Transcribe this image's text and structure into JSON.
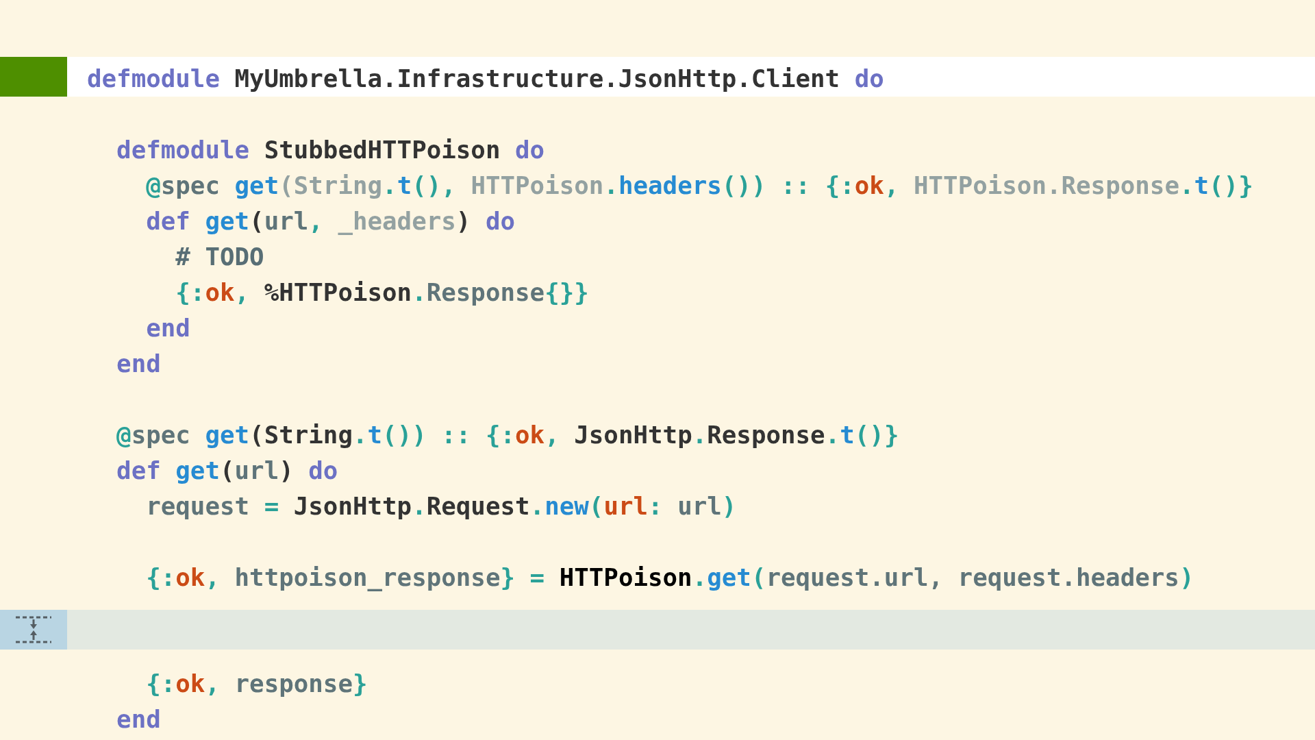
{
  "editor": {
    "lines": [
      {
        "kind": "code",
        "current": true,
        "tokens": [
          {
            "kind": "kw",
            "text": "defmodule "
          },
          {
            "kind": "mod",
            "text": "MyUmbrella.Infrastructure.JsonHttp.Client "
          },
          {
            "kind": "kw",
            "text": "do"
          }
        ]
      },
      {
        "kind": "blank",
        "current": false
      },
      {
        "kind": "code",
        "current": false,
        "tokens": [
          {
            "kind": "kw",
            "text": "  defmodule "
          },
          {
            "kind": "mod",
            "text": "StubbedHTTPoison "
          },
          {
            "kind": "kw",
            "text": "do"
          }
        ]
      },
      {
        "kind": "code",
        "current": false,
        "tokens": [
          {
            "kind": "punct",
            "text": "    @"
          },
          {
            "kind": "var",
            "text": "spec "
          },
          {
            "kind": "fn",
            "text": "get"
          },
          {
            "kind": "type",
            "text": "(String"
          },
          {
            "kind": "punct",
            "text": "."
          },
          {
            "kind": "fn",
            "text": "t"
          },
          {
            "kind": "punct",
            "text": "(), "
          },
          {
            "kind": "type",
            "text": "HTTPoison"
          },
          {
            "kind": "punct",
            "text": "."
          },
          {
            "kind": "fn",
            "text": "headers"
          },
          {
            "kind": "punct",
            "text": "()) :: {:"
          },
          {
            "kind": "atom",
            "text": "ok"
          },
          {
            "kind": "punct",
            "text": ", "
          },
          {
            "kind": "type",
            "text": "HTTPoison.Response"
          },
          {
            "kind": "punct",
            "text": "."
          },
          {
            "kind": "fn",
            "text": "t"
          },
          {
            "kind": "punct",
            "text": "()}"
          }
        ]
      },
      {
        "kind": "code",
        "current": false,
        "tokens": [
          {
            "kind": "kw",
            "text": "    def "
          },
          {
            "kind": "fn",
            "text": "get"
          },
          {
            "kind": "mod",
            "text": "("
          },
          {
            "kind": "var",
            "text": "url"
          },
          {
            "kind": "punct",
            "text": ", "
          },
          {
            "kind": "type",
            "text": "_headers"
          },
          {
            "kind": "mod",
            "text": ")"
          },
          {
            "kind": "kw",
            "text": " do"
          }
        ]
      },
      {
        "kind": "code",
        "current": false,
        "tokens": [
          {
            "kind": "comment",
            "text": "      # TODO"
          }
        ]
      },
      {
        "kind": "code",
        "current": false,
        "tokens": [
          {
            "kind": "punct",
            "text": "      {:"
          },
          {
            "kind": "atom",
            "text": "ok"
          },
          {
            "kind": "punct",
            "text": ", "
          },
          {
            "kind": "mod",
            "text": "%HTTPoison"
          },
          {
            "kind": "punct",
            "text": "."
          },
          {
            "kind": "var",
            "text": "Response"
          },
          {
            "kind": "punct",
            "text": "{}}"
          }
        ]
      },
      {
        "kind": "code",
        "current": false,
        "tokens": [
          {
            "kind": "kw",
            "text": "    end"
          }
        ]
      },
      {
        "kind": "code",
        "current": false,
        "tokens": [
          {
            "kind": "kw",
            "text": "  end"
          }
        ]
      },
      {
        "kind": "blank",
        "current": false
      },
      {
        "kind": "code",
        "current": false,
        "tokens": [
          {
            "kind": "punct",
            "text": "  @"
          },
          {
            "kind": "var",
            "text": "spec "
          },
          {
            "kind": "fn",
            "text": "get"
          },
          {
            "kind": "mod",
            "text": "(String"
          },
          {
            "kind": "punct",
            "text": "."
          },
          {
            "kind": "fn",
            "text": "t"
          },
          {
            "kind": "punct",
            "text": "()) :: {:"
          },
          {
            "kind": "atom",
            "text": "ok"
          },
          {
            "kind": "punct",
            "text": ", "
          },
          {
            "kind": "mod",
            "text": "JsonHttp"
          },
          {
            "kind": "punct",
            "text": "."
          },
          {
            "kind": "mod",
            "text": "Response"
          },
          {
            "kind": "punct",
            "text": "."
          },
          {
            "kind": "fn",
            "text": "t"
          },
          {
            "kind": "punct",
            "text": "()}"
          }
        ]
      },
      {
        "kind": "code",
        "current": false,
        "tokens": [
          {
            "kind": "kw",
            "text": "  def "
          },
          {
            "kind": "fn",
            "text": "get"
          },
          {
            "kind": "mod",
            "text": "("
          },
          {
            "kind": "var",
            "text": "url"
          },
          {
            "kind": "mod",
            "text": ") "
          },
          {
            "kind": "kw",
            "text": "do"
          }
        ]
      },
      {
        "kind": "code",
        "current": false,
        "tokens": [
          {
            "kind": "var",
            "text": "    request "
          },
          {
            "kind": "punct",
            "text": "= "
          },
          {
            "kind": "mod",
            "text": "JsonHttp"
          },
          {
            "kind": "punct",
            "text": "."
          },
          {
            "kind": "mod",
            "text": "Request"
          },
          {
            "kind": "punct",
            "text": "."
          },
          {
            "kind": "fn",
            "text": "new"
          },
          {
            "kind": "punct",
            "text": "("
          },
          {
            "kind": "atom",
            "text": "url"
          },
          {
            "kind": "punct",
            "text": ": "
          },
          {
            "kind": "var",
            "text": "url"
          },
          {
            "kind": "punct",
            "text": ")"
          }
        ]
      },
      {
        "kind": "blank",
        "current": false
      },
      {
        "kind": "code",
        "current": false,
        "tokens": [
          {
            "kind": "punct",
            "text": "    {:"
          },
          {
            "kind": "atom",
            "text": "ok"
          },
          {
            "kind": "punct",
            "text": ", "
          },
          {
            "kind": "var",
            "text": "httpoison_response"
          },
          {
            "kind": "punct",
            "text": "} = "
          },
          {
            "kind": "strong",
            "text": "HTTPoison"
          },
          {
            "kind": "punct",
            "text": "."
          },
          {
            "kind": "fn",
            "text": "get"
          },
          {
            "kind": "punct",
            "text": "("
          },
          {
            "kind": "var",
            "text": "request.url, request.headers"
          },
          {
            "kind": "punct",
            "text": ")"
          }
        ]
      },
      {
        "kind": "fold"
      },
      {
        "kind": "code",
        "current": false,
        "tokens": [
          {
            "kind": "punct",
            "text": "    {:"
          },
          {
            "kind": "atom",
            "text": "ok"
          },
          {
            "kind": "punct",
            "text": ", "
          },
          {
            "kind": "var",
            "text": "response"
          },
          {
            "kind": "punct",
            "text": "}"
          }
        ]
      },
      {
        "kind": "code",
        "current": false,
        "tokens": [
          {
            "kind": "kw",
            "text": "  end"
          }
        ]
      }
    ]
  }
}
